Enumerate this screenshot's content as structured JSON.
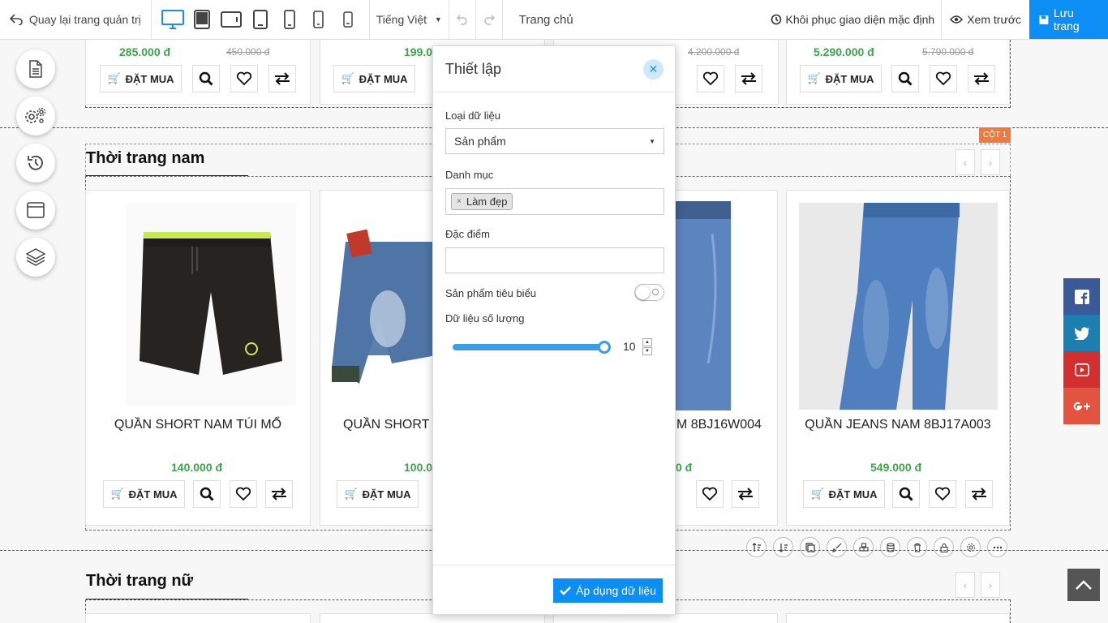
{
  "topbar": {
    "back_label": "Quay lại trang quản trị",
    "language": "Tiếng Việt",
    "page_name": "Trang chủ",
    "restore_label": "Khôi phục giao diện mặc định",
    "preview_label": "Xem trước",
    "save_label": "Lưu trang",
    "devices": [
      "desktop-icon",
      "tablet-landscape-icon",
      "tablet-wide-icon",
      "tablet-portrait-icon",
      "phone-large-icon",
      "phone-medium-icon",
      "phone-small-icon"
    ]
  },
  "top_row": {
    "prices": [
      "285.000 đ",
      "199.0",
      "5.290.000 đ"
    ],
    "old_prices": [
      "450.000 đ",
      "4.200.000 đ",
      "5.790.000 đ"
    ],
    "buy_label": "ĐẶT MUA"
  },
  "section_men": {
    "title": "Thời trang nam",
    "column_badge": "CỘT 1",
    "products": [
      {
        "name": "QUẦN SHORT NAM TÚI MỔ",
        "price": "140.000 đ"
      },
      {
        "name": "QUẦN SHORT J",
        "price": "100.0"
      },
      {
        "name": "M 8BJ16W004",
        "price": "0 đ"
      },
      {
        "name": "QUẦN JEANS NAM 8BJ17A003",
        "price": "549.000 đ"
      }
    ],
    "buy_label": "ĐẶT MUA"
  },
  "section_women": {
    "title": "Thời trang nữ"
  },
  "modal": {
    "title": "Thiết lập",
    "data_type_label": "Loại dữ liệu",
    "data_type_value": "Sản phẩm",
    "category_label": "Danh mục",
    "category_tag": "Làm đẹp",
    "feature_label": "Đặc điểm",
    "featured_label": "Sản phẩm tiêu biểu",
    "featured_on": false,
    "quantity_label": "Dữ liệu số lượng",
    "quantity_value": "10",
    "quantity_fraction": 1.0,
    "apply_label": "Áp dụng dữ liệu"
  },
  "colors": {
    "accent": "#0d8ef5",
    "price": "#3fa34d",
    "badge": "#f07a3a",
    "facebook": "#3b5998",
    "twitter": "#1d7fb0",
    "youtube": "#d32f2f",
    "gplus": "#e25340"
  }
}
